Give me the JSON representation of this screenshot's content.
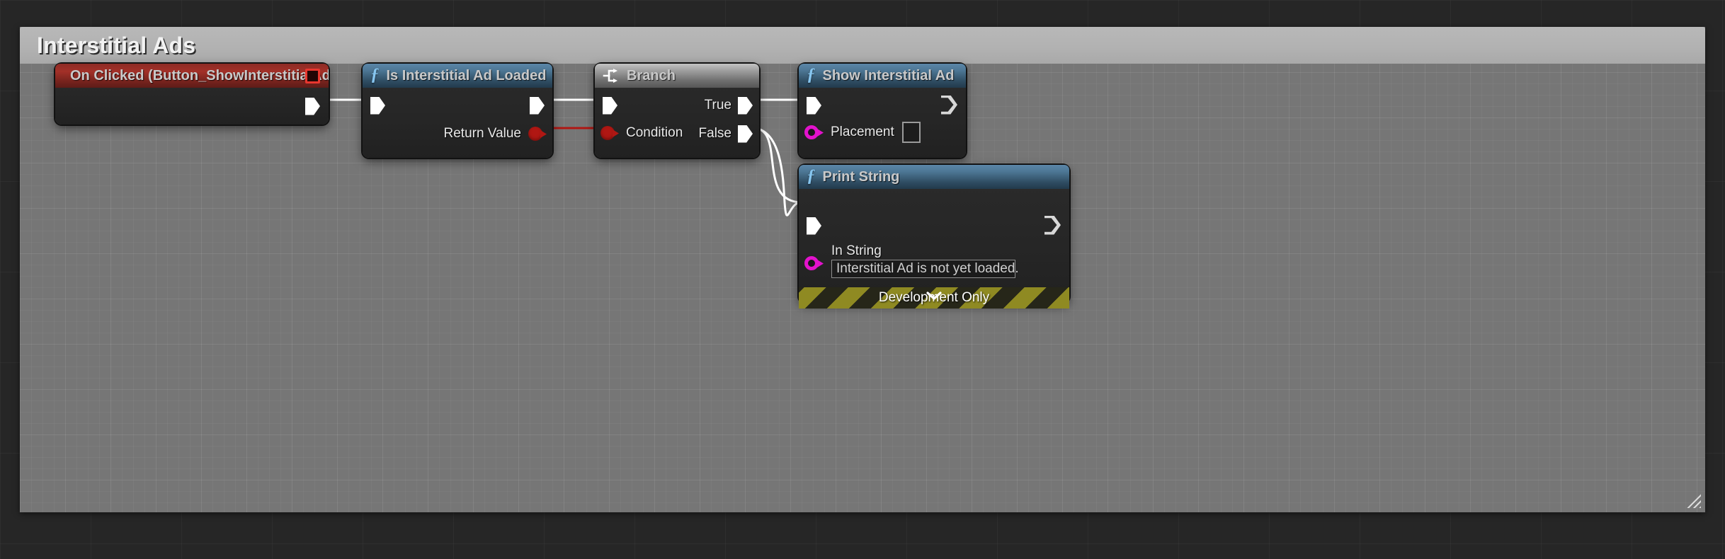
{
  "panel": {
    "title": "Interstitial Ads",
    "resize_grip_icon": "resize-grip-icon"
  },
  "nodes": [
    {
      "id": "on-clicked-event",
      "kind": "event",
      "icon": "event-diamond-icon",
      "title": "On Clicked (Button_ShowInterstitialAd)",
      "stop_icon": "stop-square-icon",
      "outputs": [
        {
          "label": "",
          "type": "exec"
        }
      ]
    },
    {
      "id": "is-interstitial-ad-loaded",
      "kind": "function",
      "icon": "function-f-icon",
      "title": "Is Interstitial Ad Loaded",
      "inputs": [
        {
          "label": "",
          "type": "exec"
        }
      ],
      "outputs": [
        {
          "label": "",
          "type": "exec"
        },
        {
          "label": "Return Value",
          "type": "bool"
        }
      ]
    },
    {
      "id": "branch",
      "kind": "branch",
      "icon": "branch-icon",
      "title": "Branch",
      "inputs": [
        {
          "label": "",
          "type": "exec"
        },
        {
          "label": "Condition",
          "type": "bool"
        }
      ],
      "outputs": [
        {
          "label": "True",
          "type": "exec"
        },
        {
          "label": "False",
          "type": "exec"
        }
      ]
    },
    {
      "id": "show-interstitial-ad",
      "kind": "function",
      "icon": "function-f-icon",
      "title": "Show Interstitial Ad",
      "inputs": [
        {
          "label": "",
          "type": "exec"
        },
        {
          "label": "Placement",
          "type": "string",
          "value": ""
        }
      ],
      "outputs": [
        {
          "label": "",
          "type": "exec-unconnected"
        }
      ]
    },
    {
      "id": "print-string",
      "kind": "function",
      "icon": "function-f-icon",
      "title": "Print String",
      "inputs": [
        {
          "label": "",
          "type": "exec"
        },
        {
          "label": "In String",
          "type": "string",
          "value": "Interstitial Ad is not yet loaded."
        }
      ],
      "outputs": [
        {
          "label": "",
          "type": "exec-unconnected"
        }
      ],
      "footer": {
        "label": "Development Only",
        "expander_icon": "chevron-down-icon"
      }
    }
  ],
  "colors": {
    "exec_wire": "#ffffff",
    "bool_wire": "#b01713",
    "event_header": "#a33028",
    "function_header": "#4d7795",
    "branch_header": "#a2a2a2",
    "string_pin": "#e312cc",
    "bool_pin": "#b01713",
    "hazard_stripe": "#8f8a22",
    "panel_header": "#b2b2b2"
  }
}
